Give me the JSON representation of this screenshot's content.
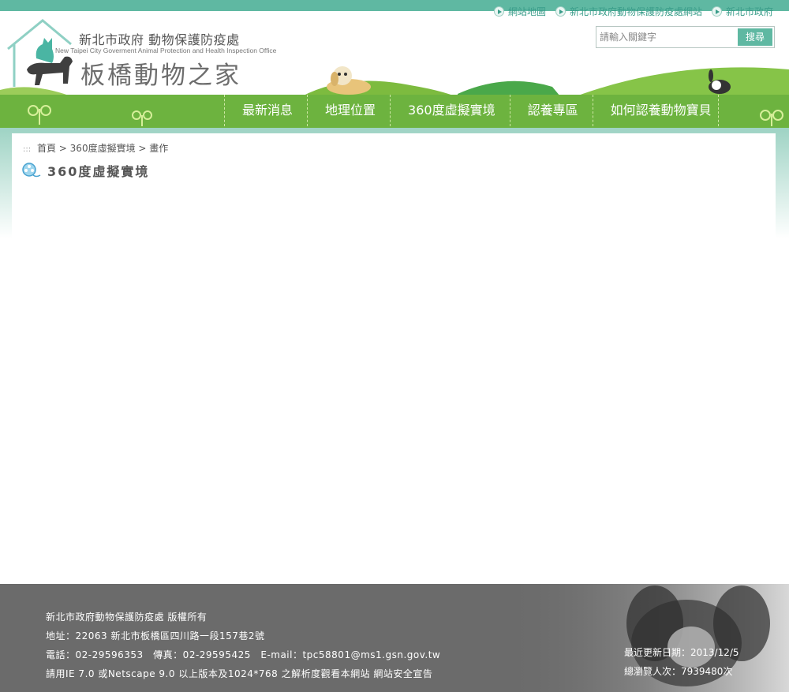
{
  "header": {
    "org_name": "新北市政府 動物保護防疫處",
    "org_name_en": "New Taipei City Goverment Animal Protection and Health Inspection Office",
    "site_name": "板橋動物之家"
  },
  "top_links": [
    {
      "label": "網站地圖"
    },
    {
      "label": "新北市政府動物保護防疫處網站"
    },
    {
      "label": "新北市政府"
    }
  ],
  "search": {
    "placeholder": "請輸入關鍵字",
    "button_label": "搜尋"
  },
  "nav": [
    {
      "label": "最新消息"
    },
    {
      "label": "地理位置"
    },
    {
      "label": "360度虛擬實境"
    },
    {
      "label": "認養專區"
    },
    {
      "label": "如何認養動物寶貝"
    }
  ],
  "breadcrumb": {
    "marker": ":::",
    "home": "首頁",
    "level1": "360度虛擬實境",
    "level2": "畫作",
    "separator": ">"
  },
  "page_title": "360度虛擬實境",
  "footer": {
    "copyright": "新北市政府動物保護防疫處 版權所有",
    "address": "地址：22063 新北市板橋區四川路一段157巷2號",
    "contact": "電話：02-29596353　傳真：02-29595425　E-mail：tpc58801@ms1.gsn.gov.tw",
    "browser_note": "請用IE 7.0 或Netscape 9.0 以上版本及1024*768 之解析度觀看本網站",
    "security_link": "網站安全宣告",
    "last_update": "最近更新日期：2013/12/5",
    "visits": "總瀏覽人次：7939480次"
  },
  "colors": {
    "teal": "#5fb8a2",
    "grass": "#6db33f",
    "footer_bg": "#6b6b6b"
  }
}
